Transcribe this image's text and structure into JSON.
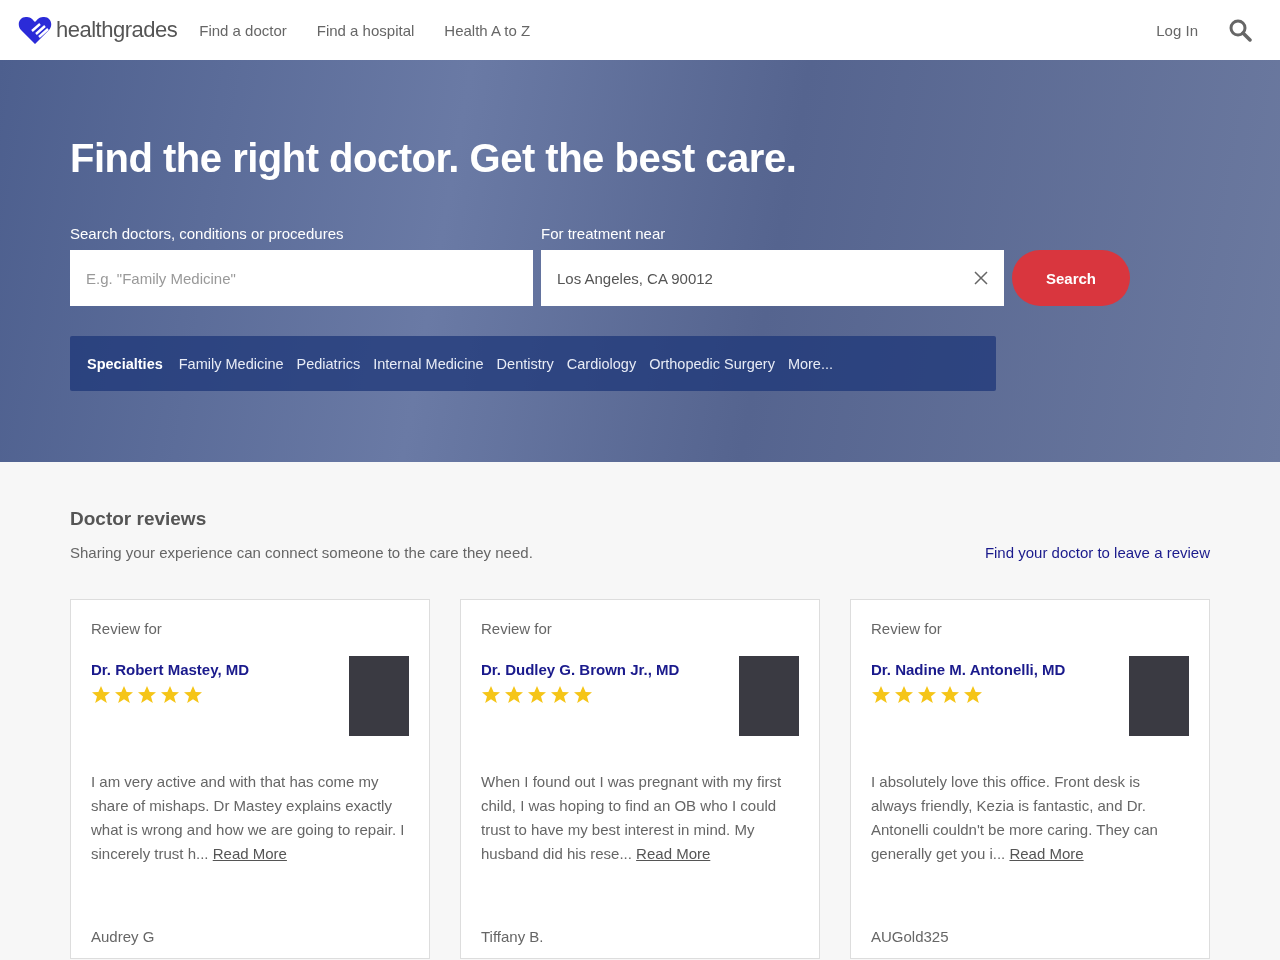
{
  "header": {
    "logo": "healthgrades",
    "nav": [
      "Find a doctor",
      "Find a hospital",
      "Health A to Z"
    ],
    "login": "Log In"
  },
  "hero": {
    "title": "Find the right doctor. Get the best care.",
    "search": {
      "label": "Search doctors, conditions or procedures",
      "placeholder": "E.g. \"Family Medicine\""
    },
    "location": {
      "label": "For treatment near",
      "value": "Los Angeles, CA 90012"
    },
    "button": "Search",
    "specialties": {
      "label": "Specialties",
      "items": [
        "Family Medicine",
        "Pediatrics",
        "Internal Medicine",
        "Dentistry",
        "Cardiology",
        "Orthopedic Surgery",
        "More..."
      ]
    }
  },
  "reviews": {
    "title": "Doctor reviews",
    "subtitle": "Sharing your experience can connect someone to the care they need.",
    "link": "Find your doctor to leave a review",
    "cards": [
      {
        "label": "Review for",
        "doctor": "Dr. Robert Mastey, MD",
        "stars": 5,
        "text": "I am very active and with that has come my share of mishaps. Dr Mastey explains exactly what is wrong and how we are going to repair. I sincerely trust h...",
        "read_more": "Read More",
        "author": "Audrey G"
      },
      {
        "label": "Review for",
        "doctor": "Dr. Dudley G. Brown Jr., MD",
        "stars": 5,
        "text": "When I found out I was pregnant with my first child, I was hoping to find an OB who I could trust to have my best interest in mind. My husband did his rese...",
        "read_more": "Read More",
        "author": "Tiffany B."
      },
      {
        "label": "Review for",
        "doctor": "Dr. Nadine M. Antonelli, MD",
        "stars": 5,
        "text": "I absolutely love this office. Front desk is always friendly, Kezia is fantastic, and Dr. Antonelli couldn't be more caring. They can generally get you i...",
        "read_more": "Read More",
        "author": "AUGold325"
      }
    ]
  }
}
